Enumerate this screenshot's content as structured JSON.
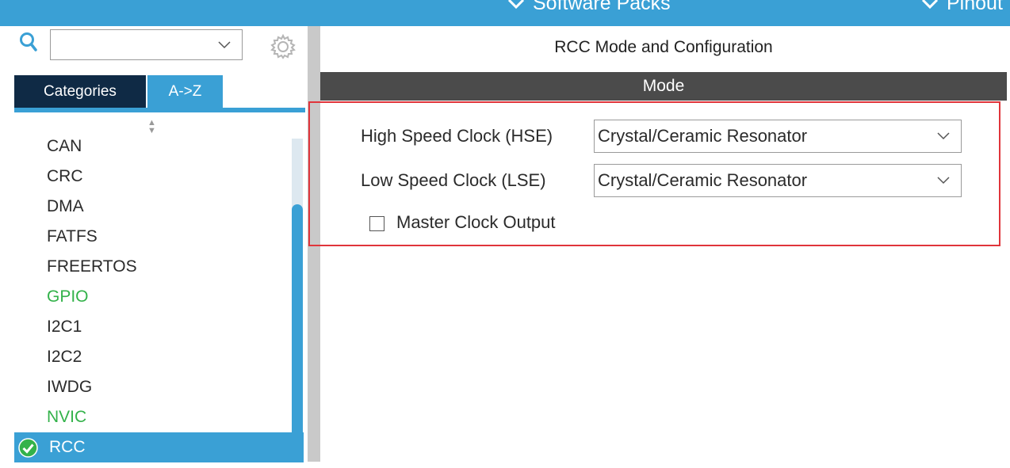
{
  "topbar": {
    "menus": [
      {
        "label": "Software Packs",
        "icon": "chevron-down-icon"
      },
      {
        "label": "Pinout",
        "icon": "chevron-down-icon"
      }
    ]
  },
  "sidebar": {
    "search": {
      "value": "",
      "placeholder": ""
    },
    "tabs": [
      {
        "label": "Categories"
      },
      {
        "label": "A->Z"
      }
    ],
    "items": [
      {
        "label": "CAN",
        "status": "normal"
      },
      {
        "label": "CRC",
        "status": "normal"
      },
      {
        "label": "DMA",
        "status": "normal"
      },
      {
        "label": "FATFS",
        "status": "normal"
      },
      {
        "label": "FREERTOS",
        "status": "normal"
      },
      {
        "label": "GPIO",
        "status": "configured"
      },
      {
        "label": "I2C1",
        "status": "normal"
      },
      {
        "label": "I2C2",
        "status": "normal"
      },
      {
        "label": "IWDG",
        "status": "normal"
      },
      {
        "label": "NVIC",
        "status": "configured"
      },
      {
        "label": "RCC",
        "status": "selected"
      }
    ]
  },
  "main": {
    "title": "RCC Mode and Configuration",
    "section": "Mode",
    "fields": [
      {
        "label": "High Speed Clock (HSE)",
        "value": "Crystal/Ceramic Resonator"
      },
      {
        "label": "Low Speed Clock (LSE)",
        "value": "Crystal/Ceramic Resonator"
      }
    ],
    "master_clock_output": {
      "label": "Master Clock Output",
      "checked": false
    }
  },
  "colors": {
    "accent": "#3aa0d5",
    "tab_dark": "#0f2a45",
    "configured": "#33b24a",
    "highlight": "#e0353b",
    "mode_bar": "#4b4b4b"
  }
}
